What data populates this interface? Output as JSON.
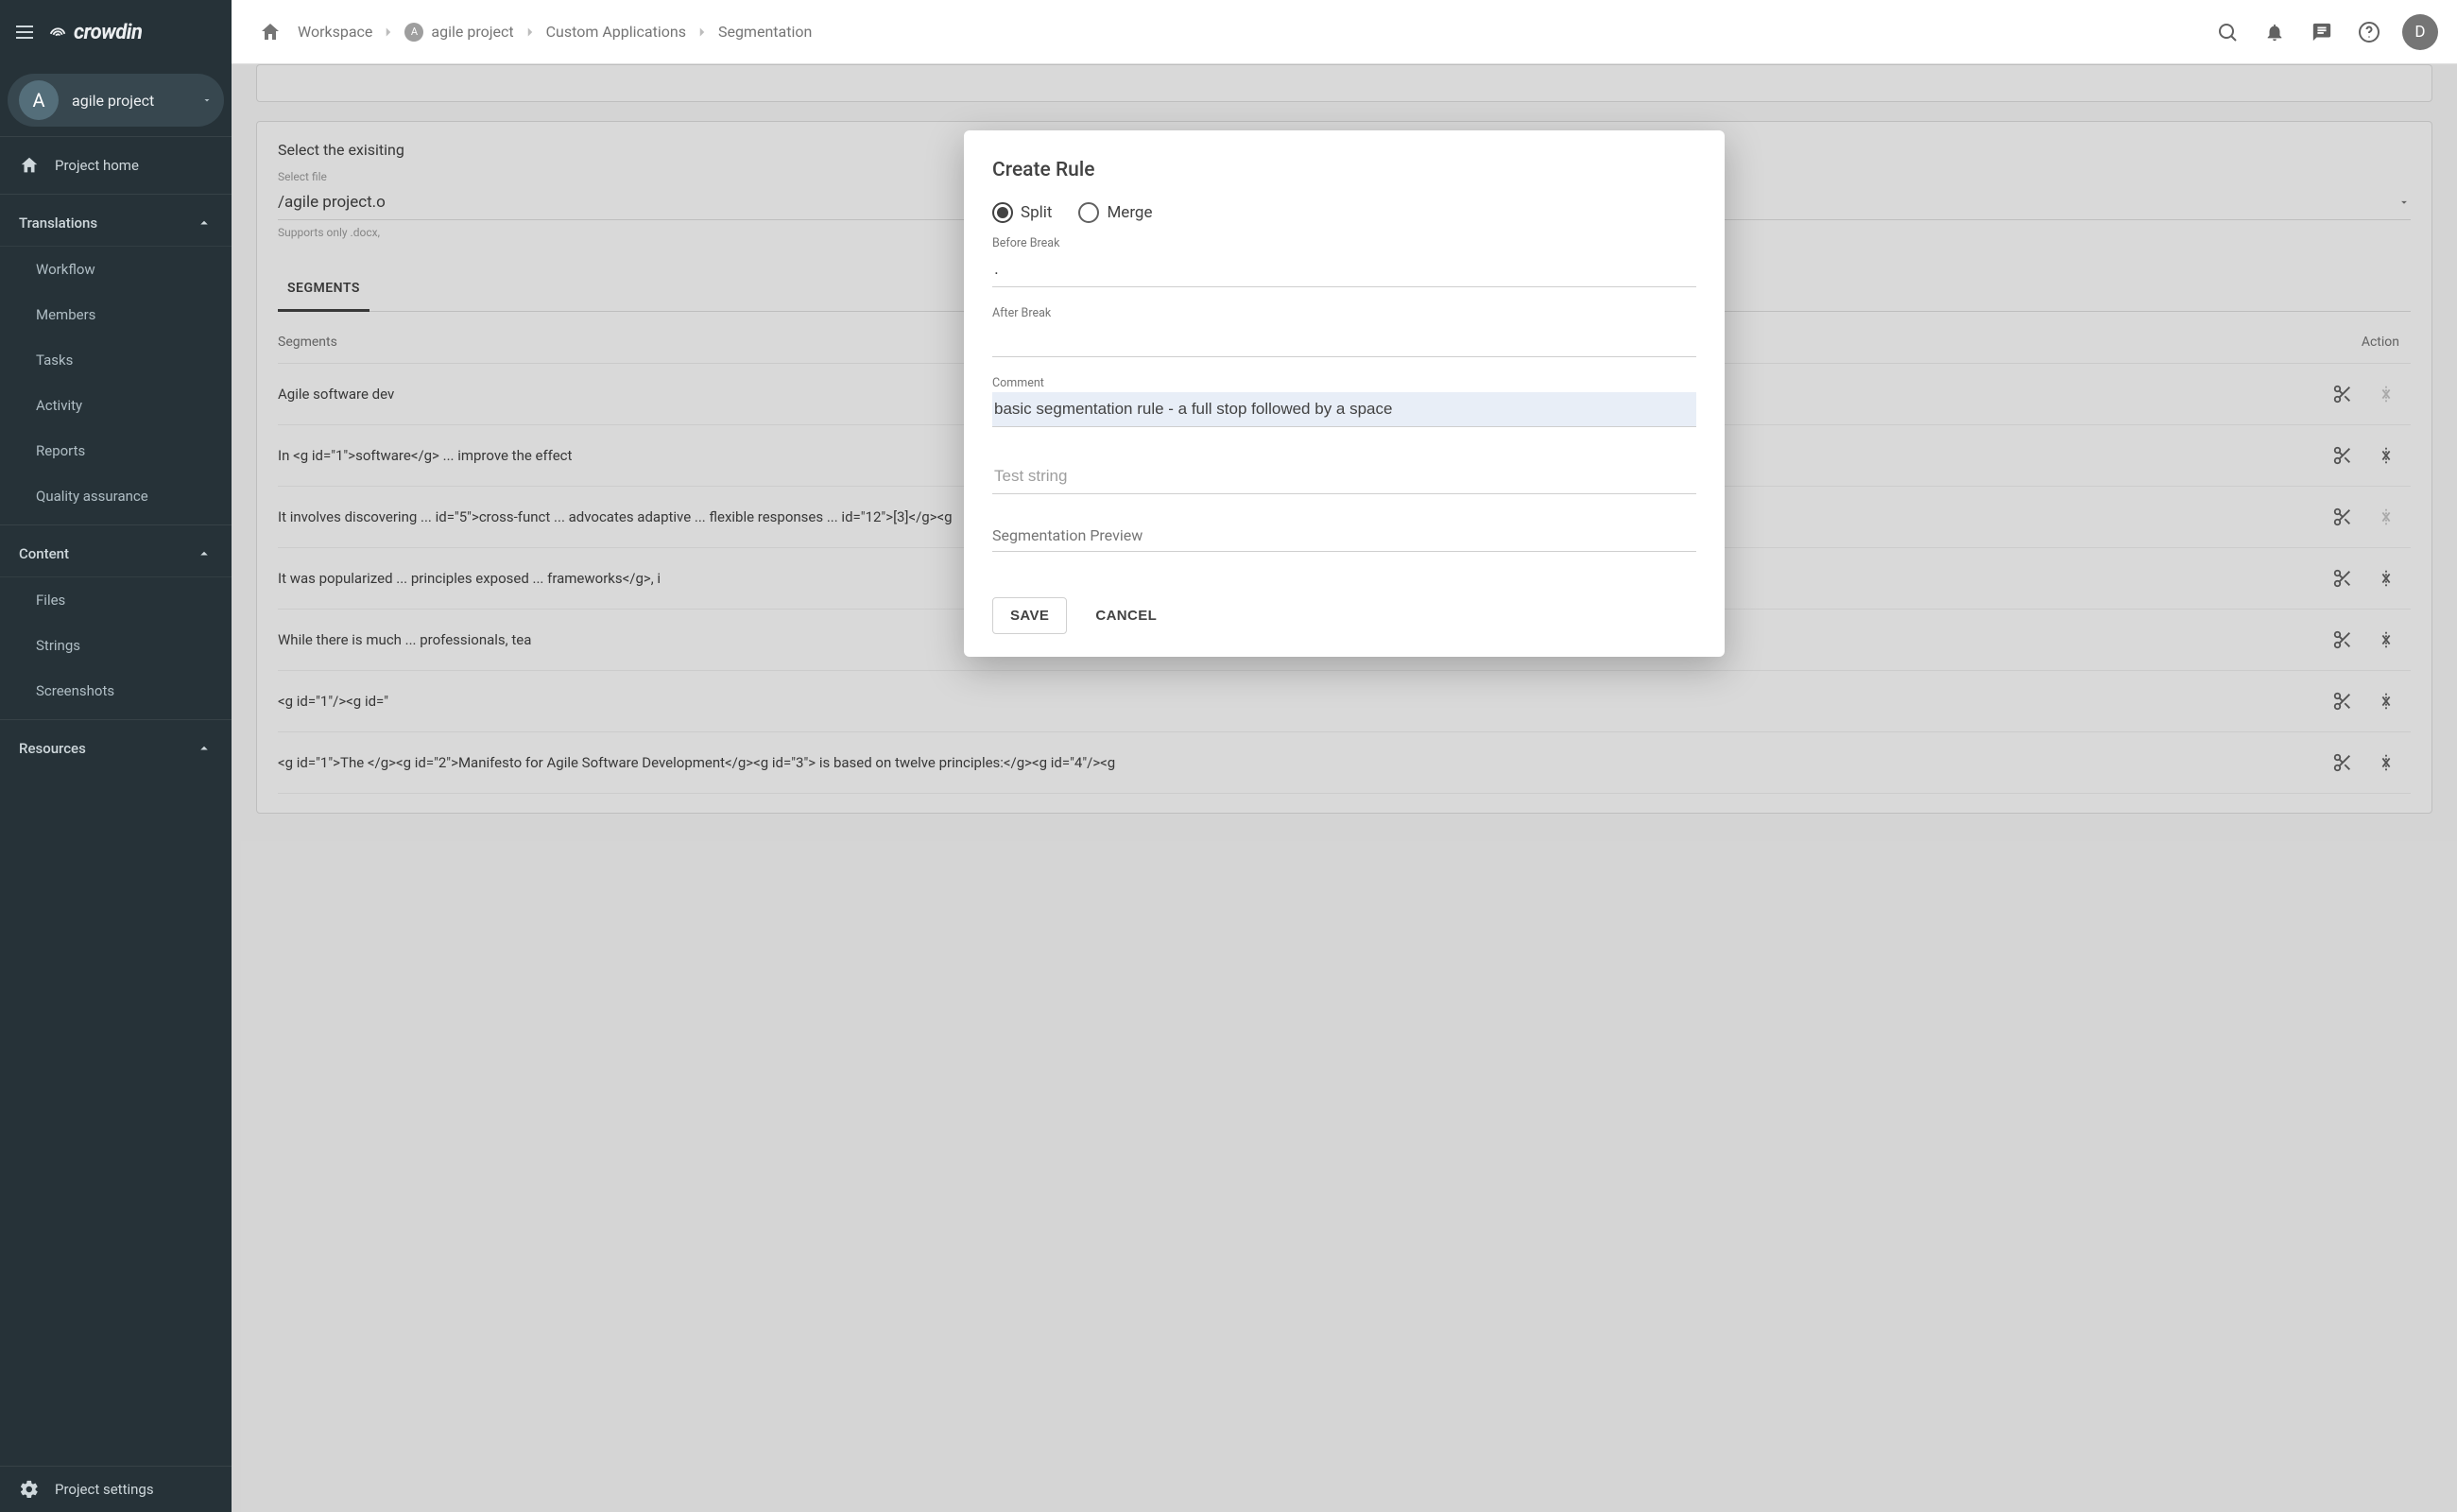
{
  "brand": "crowdin",
  "project_switch": {
    "avatar": "A",
    "label": "agile project"
  },
  "sidebar": {
    "home": "Project home",
    "sections": {
      "translations": {
        "label": "Translations",
        "items": [
          "Workflow",
          "Members",
          "Tasks",
          "Activity",
          "Reports",
          "Quality assurance"
        ]
      },
      "content": {
        "label": "Content",
        "items": [
          "Files",
          "Strings",
          "Screenshots"
        ]
      },
      "resources": {
        "label": "Resources"
      }
    },
    "settings": "Project settings"
  },
  "breadcrumb": {
    "workspace": "Workspace",
    "project_badge": "A",
    "project": "agile project",
    "app": "Custom Applications",
    "page": "Segmentation"
  },
  "user_initial": "D",
  "page": {
    "section_title_prefix": "Select the exisiting",
    "file_label": "Select file",
    "file_value_prefix": "/agile project.o",
    "hint_prefix": "Supports only .docx,",
    "tabs": {
      "segments": "SEGMENTS"
    },
    "col_segments": "Segments",
    "col_action": "Action",
    "rows": [
      "Agile software dev",
      "In <g id=\"1\">software</g> ... improve the effect",
      "It involves discovering ... id=\"5\">cross-funct ... advocates adaptive ... flexible responses ... id=\"12\">[3]</g><g",
      "It was popularized ... principles exposed ... frameworks</g>, i",
      "While there is much ... professionals, tea",
      "<g id=\"1\"/><g id=\"",
      "<g id=\"1\">The </g><g id=\"2\">Manifesto for Agile Software Development</g><g id=\"3\"> is based on twelve principles:</g><g id=\"4\"/><g"
    ]
  },
  "dialog": {
    "title": "Create Rule",
    "radio_split": "Split",
    "radio_merge": "Merge",
    "before_label": "Before Break",
    "before_value": ".",
    "after_label": "After Break",
    "after_value": "",
    "comment_label": "Comment",
    "comment_value": "basic segmentation rule - a full stop followed by a space",
    "test_placeholder": "Test string",
    "preview_label": "Segmentation Preview",
    "save": "SAVE",
    "cancel": "CANCEL"
  }
}
